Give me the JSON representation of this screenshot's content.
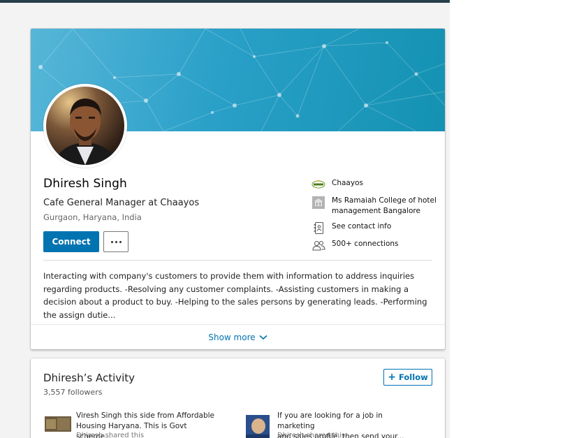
{
  "profile": {
    "name": "Dhiresh Singh",
    "headline": "Cafe General Manager at Chaayos",
    "location": "Gurgaon, Haryana, India",
    "connect_label": "Connect",
    "side_info": {
      "company": "Chaayos",
      "education_line1": "Ms Ramaiah College of hotel",
      "education_line2": "management Bangalore",
      "contact": "See contact info",
      "connections": "500+ connections"
    },
    "summary": "Interacting with company's customers to provide them with information to address inquiries regarding products. -Resolving any customer complaints. -Assisting customers in making a decision about a product to buy. -Helping to the sales persons by generating leads. -Performing the assign dutie...",
    "show_more_label": "Show more"
  },
  "activity": {
    "title": "Dhiresh’s Activity",
    "followers": "3,557 followers",
    "follow_label": "Follow",
    "posts": [
      {
        "line1": "Viresh Singh this side from Affordable",
        "line2": "Housing Haryana. This is Govt scheme...",
        "meta": "Dhiresh shared this"
      },
      {
        "line1": "If you are looking for a job in marketing",
        "line2": "and sales profile, then send your...",
        "meta": "Dhiresh shared this"
      }
    ]
  },
  "icons": {
    "company": "chaayos-logo-icon",
    "education": "school-icon",
    "contact": "contact-book-icon",
    "connections": "people-icon",
    "more": "ellipsis-icon",
    "show_more": "chevron-down-icon",
    "follow": "plus-icon"
  },
  "colors": {
    "accent": "#0073b1",
    "banner": "#1a9ac0",
    "top_bar": "#283e4a"
  }
}
